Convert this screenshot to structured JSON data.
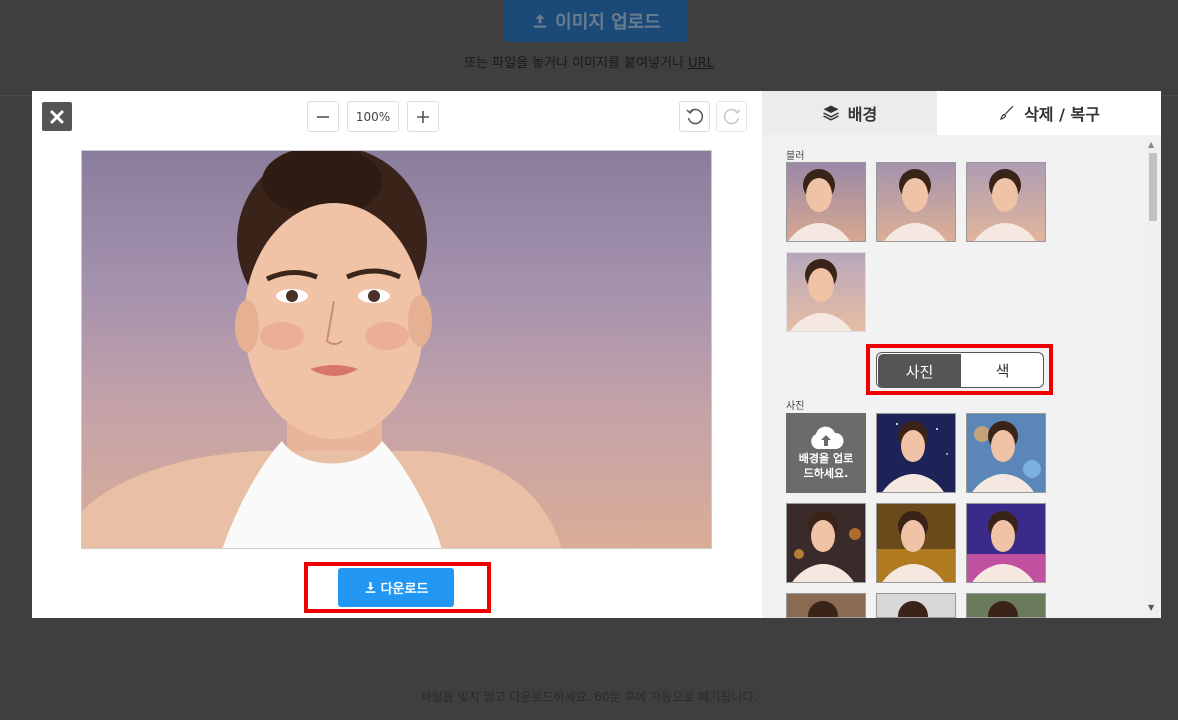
{
  "background": {
    "upload_button": "이미지 업로드",
    "hint_text": "또는 파일을 놓거나 이미지를 붙여넣거나",
    "hint_link": "URL",
    "footer": "파일을 잊지 말고 다운로드하세요. 60분 후에 자동으로 폐기됩니다."
  },
  "toolbar": {
    "zoom_level": "100%"
  },
  "download": {
    "label": "다운로드"
  },
  "side_panel": {
    "tabs": [
      {
        "label": "배경",
        "icon": "layers-icon",
        "active": true
      },
      {
        "label": "삭제 / 복구",
        "icon": "brush-icon",
        "active": false
      }
    ],
    "blur_section_label": "블러",
    "blur_thumbnails": 4,
    "toggle": {
      "photo": "사진",
      "color": "색",
      "selected": "사진"
    },
    "photo_section_label": "사진",
    "upload_tile_lines": [
      "배경을 업로",
      "드하세요."
    ]
  },
  "colors": {
    "accent": "#2196f3",
    "highlight": "#ee0000",
    "toggle_active": "#555555"
  }
}
